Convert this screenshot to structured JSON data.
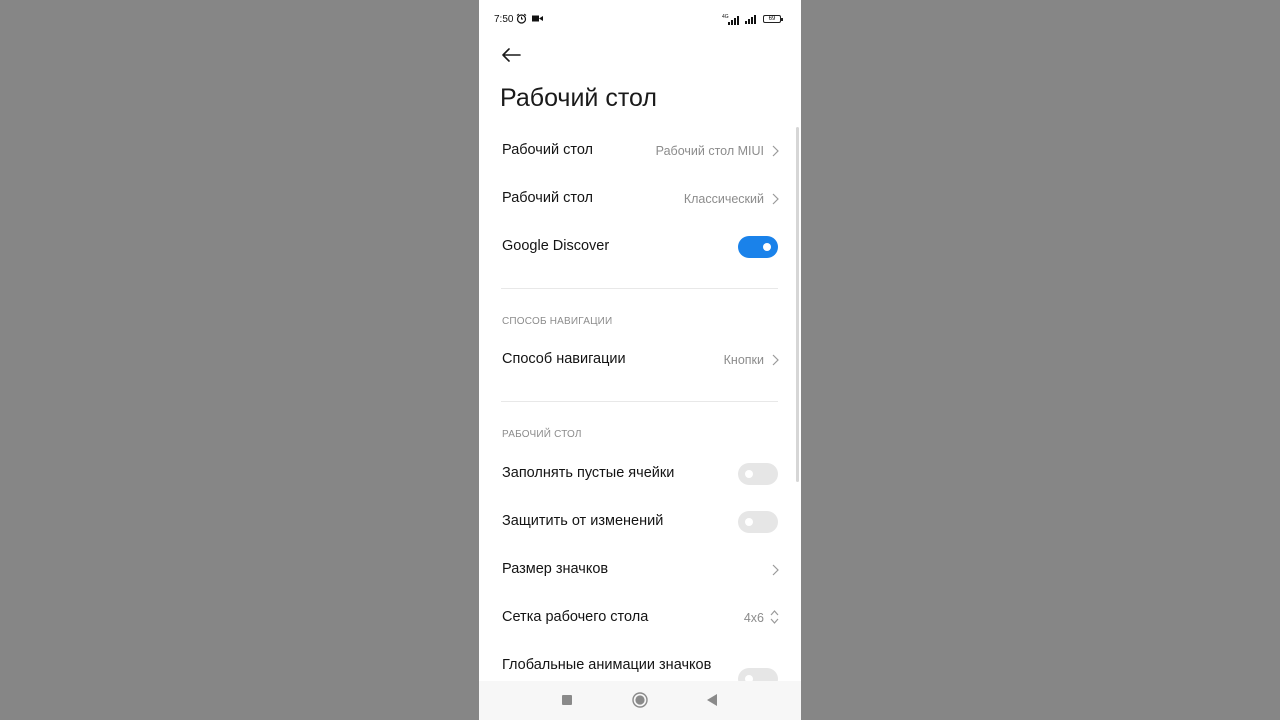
{
  "status_bar": {
    "time": "7:50",
    "battery": "69",
    "icons": [
      "alarm-icon",
      "video-camera-icon",
      "signal-4g-icon",
      "signal-icon",
      "battery-icon"
    ]
  },
  "header": {
    "back_icon": "arrow-left-icon",
    "title": "Рабочий стол"
  },
  "rows": {
    "desktop_mode": {
      "label": "Рабочий стол",
      "value": "Рабочий стол MIUI"
    },
    "desktop_style": {
      "label": "Рабочий стол",
      "value": "Классический"
    },
    "google_discover": {
      "label": "Google Discover",
      "state": "on"
    },
    "navigation_method": {
      "label": "Способ навигации",
      "value": "Кнопки"
    },
    "fill_empty_cells": {
      "label": "Заполнять пустые ячейки",
      "state": "off"
    },
    "lock_layout": {
      "label": "Защитить от изменений",
      "state": "off"
    },
    "icon_size": {
      "label": "Размер значков"
    },
    "desktop_grid": {
      "label": "Сетка рабочего стола",
      "value": "4x6"
    },
    "global_icon_animations": {
      "label": "Глобальные анимации значков",
      "state": "off"
    }
  },
  "sections": {
    "navigation": "СПОСОБ НАВИГАЦИИ",
    "desktop": "РАБОЧИЙ СТОЛ"
  },
  "nav_bar": {
    "icons": [
      "recent-apps-icon",
      "home-icon",
      "back-triangle-icon"
    ]
  },
  "colors": {
    "toggle_on": "#1a82ea",
    "toggle_off": "#e6e6e6",
    "background_dim": "#858585"
  }
}
